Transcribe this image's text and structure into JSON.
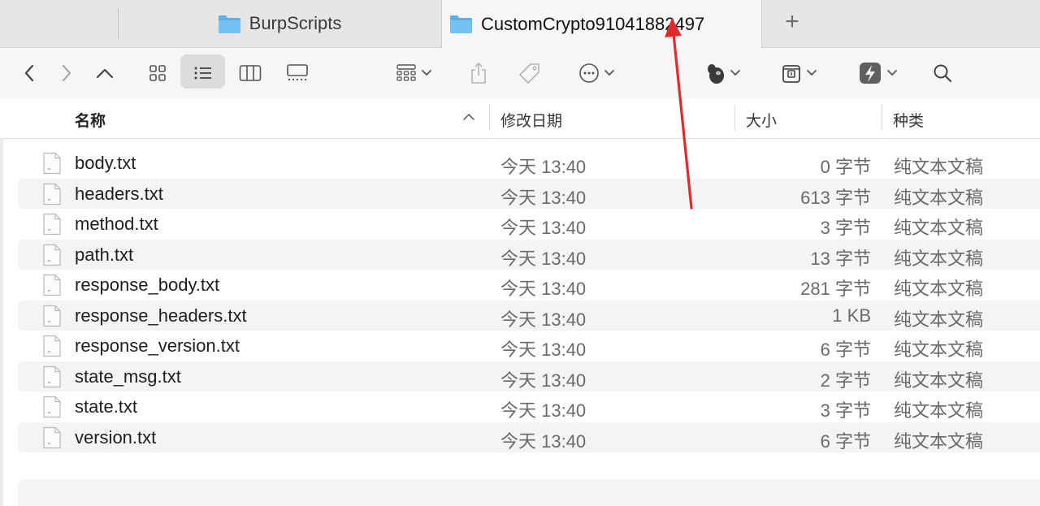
{
  "tabs": [
    {
      "label": "BurpScripts",
      "icon": "folder-icon",
      "active": false
    },
    {
      "label": "CustomCrypto91041882497",
      "icon": "folder-icon",
      "active": true
    }
  ],
  "new_tab_label": "+",
  "toolbar": {
    "icons": [
      "back-icon",
      "forward-icon",
      "up-icon",
      "icon-view-icon",
      "list-view-icon",
      "column-view-icon",
      "gallery-view-icon",
      "group-icon",
      "share-icon",
      "tag-icon",
      "more-icon",
      "app-extension-icon",
      "archive-icon",
      "app-icon",
      "search-icon"
    ]
  },
  "columns": {
    "name": "名称",
    "date": "修改日期",
    "size": "大小",
    "kind": "种类"
  },
  "files": [
    {
      "name": "body.txt",
      "date": "今天 13:40",
      "size": "0 字节",
      "kind": "纯文本文稿"
    },
    {
      "name": "headers.txt",
      "date": "今天 13:40",
      "size": "613 字节",
      "kind": "纯文本文稿"
    },
    {
      "name": "method.txt",
      "date": "今天 13:40",
      "size": "3 字节",
      "kind": "纯文本文稿"
    },
    {
      "name": "path.txt",
      "date": "今天 13:40",
      "size": "13 字节",
      "kind": "纯文本文稿"
    },
    {
      "name": "response_body.txt",
      "date": "今天 13:40",
      "size": "281 字节",
      "kind": "纯文本文稿"
    },
    {
      "name": "response_headers.txt",
      "date": "今天 13:40",
      "size": "1 KB",
      "kind": "纯文本文稿"
    },
    {
      "name": "response_version.txt",
      "date": "今天 13:40",
      "size": "6 字节",
      "kind": "纯文本文稿"
    },
    {
      "name": "state_msg.txt",
      "date": "今天 13:40",
      "size": "2 字节",
      "kind": "纯文本文稿"
    },
    {
      "name": "state.txt",
      "date": "今天 13:40",
      "size": "3 字节",
      "kind": "纯文本文稿"
    },
    {
      "name": "version.txt",
      "date": "今天 13:40",
      "size": "6 字节",
      "kind": "纯文本文稿"
    }
  ],
  "colors": {
    "folder": "#5ab0ea",
    "annotation_arrow": "#e32a2a",
    "selected_view_bg": "#dcdcdc"
  }
}
